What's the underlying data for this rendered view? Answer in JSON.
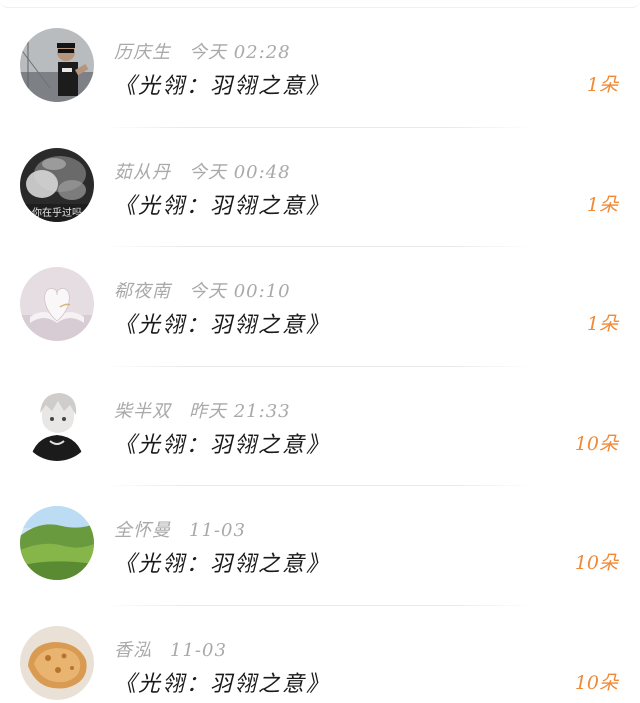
{
  "colors": {
    "accent_count": "#f08a38",
    "meta_text": "#a9a9a9",
    "message_text": "#1a1a1a"
  },
  "gift_list": [
    {
      "user": "历庆生",
      "time": "今天 02:28",
      "message": "《光翎：羽翎之意》",
      "count": "1朵",
      "avatar": "avatar-man-sunglasses"
    },
    {
      "user": "茹从丹",
      "time": "今天 00:48",
      "message": "《光翎：羽翎之意》",
      "count": "1朵",
      "avatar": "avatar-smoke-photo"
    },
    {
      "user": "郗夜南",
      "time": "今天 00:10",
      "message": "《光翎：羽翎之意》",
      "count": "1朵",
      "avatar": "avatar-book-heart"
    },
    {
      "user": "柴半双",
      "time": "昨天 21:33",
      "message": "《光翎：羽翎之意》",
      "count": "10朵",
      "avatar": "avatar-anime-boy"
    },
    {
      "user": "全怀曼",
      "time": "11-03",
      "message": "《光翎：羽翎之意》",
      "count": "10朵",
      "avatar": "avatar-green-hills"
    },
    {
      "user": "香泓",
      "time": "11-03",
      "message": "《光翎：羽翎之意》",
      "count": "10朵",
      "avatar": "avatar-bread"
    }
  ],
  "avatar_caption_2": "你在乎过吗"
}
